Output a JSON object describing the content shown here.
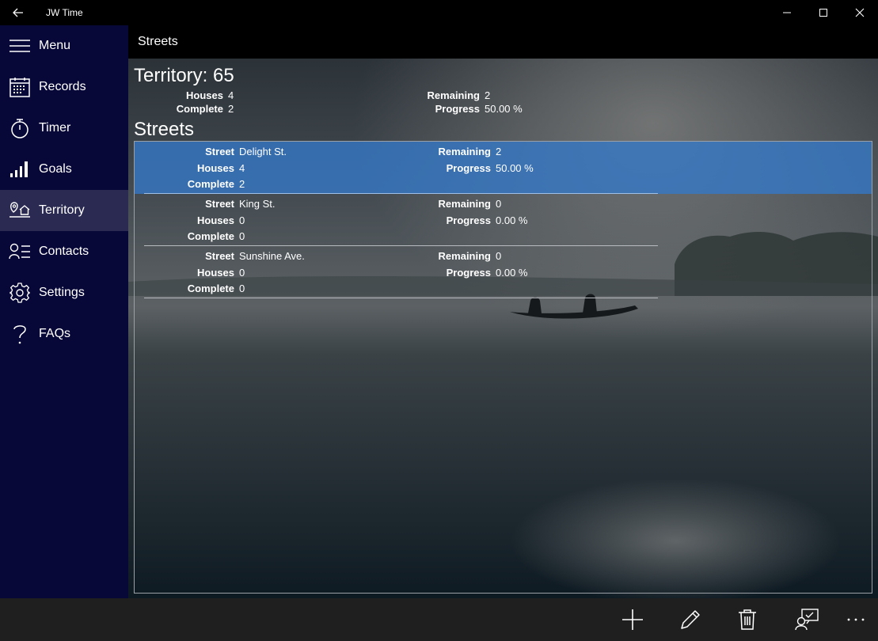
{
  "window": {
    "title": "JW Time"
  },
  "nav": {
    "items": [
      {
        "label": "Menu",
        "icon": "hamburger-icon"
      },
      {
        "label": "Records",
        "icon": "calendar-icon"
      },
      {
        "label": "Timer",
        "icon": "stopwatch-icon"
      },
      {
        "label": "Goals",
        "icon": "signal-bars-icon"
      },
      {
        "label": "Territory",
        "icon": "territory-icon"
      },
      {
        "label": "Contacts",
        "icon": "contacts-icon"
      },
      {
        "label": "Settings",
        "icon": "gear-icon"
      },
      {
        "label": "FAQs",
        "icon": "question-icon"
      }
    ],
    "selected": "Territory"
  },
  "page": {
    "title": "Streets"
  },
  "territory": {
    "title": "Territory: 65",
    "labels": {
      "houses": "Houses",
      "complete": "Complete",
      "remaining": "Remaining",
      "progress": "Progress",
      "street": "Street"
    },
    "houses": "4",
    "complete": "2",
    "remaining": "2",
    "progress": "50.00 %"
  },
  "streets": {
    "title": "Streets",
    "rows": [
      {
        "street": "Delight St.",
        "houses": "4",
        "complete": "2",
        "remaining": "2",
        "progress": "50.00 %"
      },
      {
        "street": "King St.",
        "houses": "0",
        "complete": "0",
        "remaining": "0",
        "progress": "0.00 %"
      },
      {
        "street": "Sunshine Ave.",
        "houses": "0",
        "complete": "0",
        "remaining": "0",
        "progress": "0.00 %"
      }
    ]
  },
  "commands": [
    "add-icon",
    "edit-icon",
    "delete-icon",
    "assign-icon",
    "more-icon"
  ],
  "colors": {
    "sidebar": "#080838",
    "selected_nav": "#2a2a52",
    "selected_row": "#3478c8",
    "command_bar": "#1f1f1f"
  }
}
